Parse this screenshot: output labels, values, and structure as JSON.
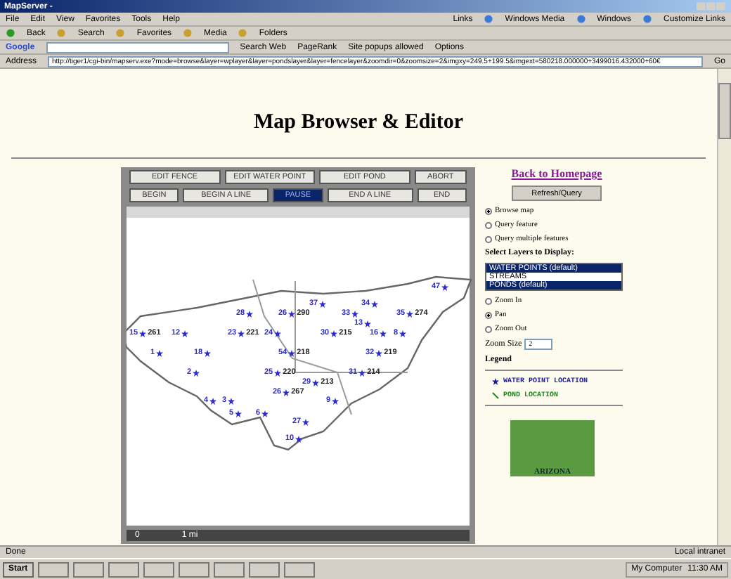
{
  "window": {
    "title": "MapServer -"
  },
  "menu": [
    "File",
    "Edit",
    "View",
    "Favorites",
    "Tools",
    "Help"
  ],
  "links": {
    "label": "Links",
    "items": [
      "Windows Media",
      "Windows",
      "Customize Links"
    ]
  },
  "toolbar": [
    "Back",
    "Search",
    "Favorites",
    "Media",
    "Folders"
  ],
  "google_bar": {
    "logo": "Google",
    "search": "Search Web",
    "pagerank": "PageRank",
    "popups": "Site popups allowed",
    "options": "Options"
  },
  "address": {
    "label": "Address",
    "value": "http://tiger1/cgi-bin/mapserv.exe?mode=browse&layer=wplayer&layer=pondslayer&layer=fencelayer&zoomdir=0&zoomsize=2&imgxy=249.5+199.5&imgext=580218.000000+3499016.432000+60€",
    "go": "Go"
  },
  "page": {
    "heading": "Map Browser & Editor"
  },
  "edit_buttons": [
    [
      {
        "label": "EDIT FENCE",
        "selected": false
      },
      {
        "label": "EDIT WATER POINT",
        "selected": false
      },
      {
        "label": "EDIT POND",
        "selected": false
      },
      {
        "label": "ABORT",
        "selected": false
      }
    ],
    [
      {
        "label": "BEGIN",
        "selected": false
      },
      {
        "label": "BEGIN A LINE",
        "selected": false
      },
      {
        "label": "PAUSE",
        "selected": true
      },
      {
        "label": "END A LINE",
        "selected": false
      },
      {
        "label": "END",
        "selected": false
      }
    ]
  ],
  "map": {
    "pins": [
      {
        "id": "47"
      },
      {
        "id": "37"
      },
      {
        "id": "34"
      },
      {
        "id": "28"
      },
      {
        "id": "26",
        "value": "290"
      },
      {
        "id": "33"
      },
      {
        "id": "35",
        "value": "274"
      },
      {
        "id": "13"
      },
      {
        "id": "15",
        "value": "261"
      },
      {
        "id": "12"
      },
      {
        "id": "23",
        "value": "221"
      },
      {
        "id": "24"
      },
      {
        "id": "30",
        "value": "215"
      },
      {
        "id": "16"
      },
      {
        "id": "8"
      },
      {
        "id": "1"
      },
      {
        "id": "18"
      },
      {
        "id": "54",
        "value": "218"
      },
      {
        "id": "32",
        "value": "219"
      },
      {
        "id": "2"
      },
      {
        "id": "25",
        "value": "220"
      },
      {
        "id": "31",
        "value": "214"
      },
      {
        "id": "29",
        "value": "213"
      },
      {
        "id": "26",
        "value": "267"
      },
      {
        "id": "4"
      },
      {
        "id": "3"
      },
      {
        "id": "9"
      },
      {
        "id": "5"
      },
      {
        "id": "6"
      },
      {
        "id": "27"
      },
      {
        "id": "10"
      }
    ],
    "scale": {
      "start": "0",
      "end": "1 mi"
    }
  },
  "side": {
    "home_link": "Back to Homepage",
    "refresh": "Refresh/Query",
    "modes": [
      {
        "label": "Browse map",
        "selected": true
      },
      {
        "label": "Query feature",
        "selected": false
      },
      {
        "label": "Query multiple features",
        "selected": false
      }
    ],
    "layers_label": "Select Layers to Display:",
    "layers": [
      {
        "label": "WATER POINTS (default)",
        "selected": true
      },
      {
        "label": "STREAMS",
        "selected": false
      },
      {
        "label": "PONDS (default)",
        "selected": true
      }
    ],
    "zoom": [
      {
        "label": "Zoom In",
        "selected": false
      },
      {
        "label": "Pan",
        "selected": true
      },
      {
        "label": "Zoom Out",
        "selected": false
      }
    ],
    "zoom_size": {
      "label": "Zoom Size",
      "value": "2"
    },
    "legend": {
      "title": "Legend",
      "items": [
        {
          "kind": "water",
          "label": "WATER POINT LOCATION",
          "color": "#1a1aa0"
        },
        {
          "kind": "pond",
          "label": "POND LOCATION",
          "color": "#1a8a1a"
        }
      ]
    },
    "state_map": "ARIZONA"
  },
  "status_bar": {
    "text": "Done",
    "zone": "Local intranet"
  },
  "taskbar": {
    "start": "Start",
    "computer": "My Computer",
    "clock": "11:30 AM"
  }
}
